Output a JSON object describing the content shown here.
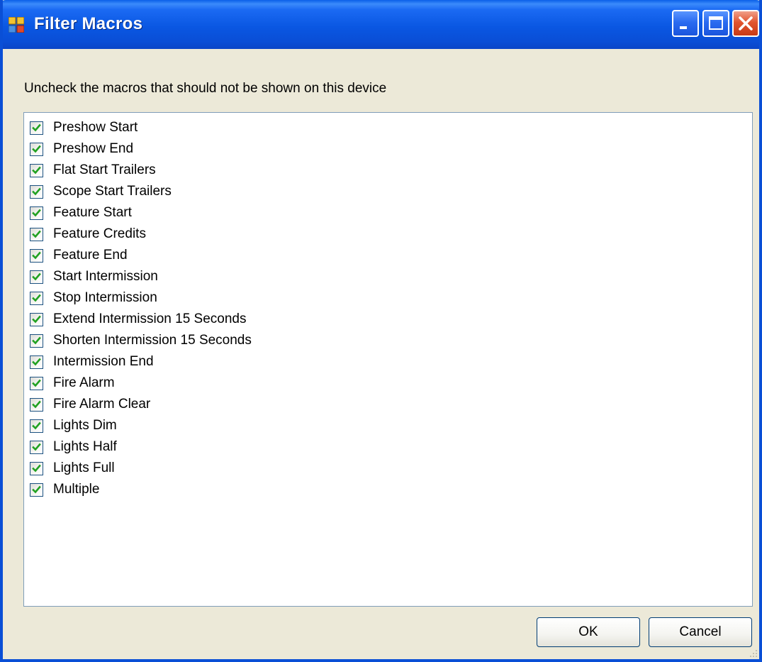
{
  "window": {
    "title": "Filter Macros",
    "app_icon": "window-app-icon",
    "controls": {
      "minimize": "minimize-icon",
      "maximize": "maximize-icon",
      "close": "close-icon"
    }
  },
  "instruction": "Uncheck the macros that should not be shown on this device",
  "macros": [
    {
      "label": "Preshow Start",
      "checked": true
    },
    {
      "label": "Preshow End",
      "checked": true
    },
    {
      "label": "Flat Start Trailers",
      "checked": true
    },
    {
      "label": "Scope Start Trailers",
      "checked": true
    },
    {
      "label": "Feature Start",
      "checked": true
    },
    {
      "label": "Feature Credits",
      "checked": true
    },
    {
      "label": "Feature End",
      "checked": true
    },
    {
      "label": "Start Intermission",
      "checked": true
    },
    {
      "label": "Stop Intermission",
      "checked": true
    },
    {
      "label": "Extend Intermission 15 Seconds",
      "checked": true
    },
    {
      "label": "Shorten Intermission 15 Seconds",
      "checked": true
    },
    {
      "label": "Intermission End",
      "checked": true
    },
    {
      "label": "Fire Alarm",
      "checked": true
    },
    {
      "label": "Fire Alarm Clear",
      "checked": true
    },
    {
      "label": "Lights Dim",
      "checked": true
    },
    {
      "label": "Lights Half",
      "checked": true
    },
    {
      "label": "Lights Full",
      "checked": true
    },
    {
      "label": "Multiple",
      "checked": true
    }
  ],
  "buttons": {
    "ok_label": "OK",
    "cancel_label": "Cancel"
  },
  "colors": {
    "titlebar": "#0a4ed6",
    "dialog_background": "#ece9d8",
    "check_mark": "#21a121",
    "checkbox_border": "#1c5180"
  }
}
